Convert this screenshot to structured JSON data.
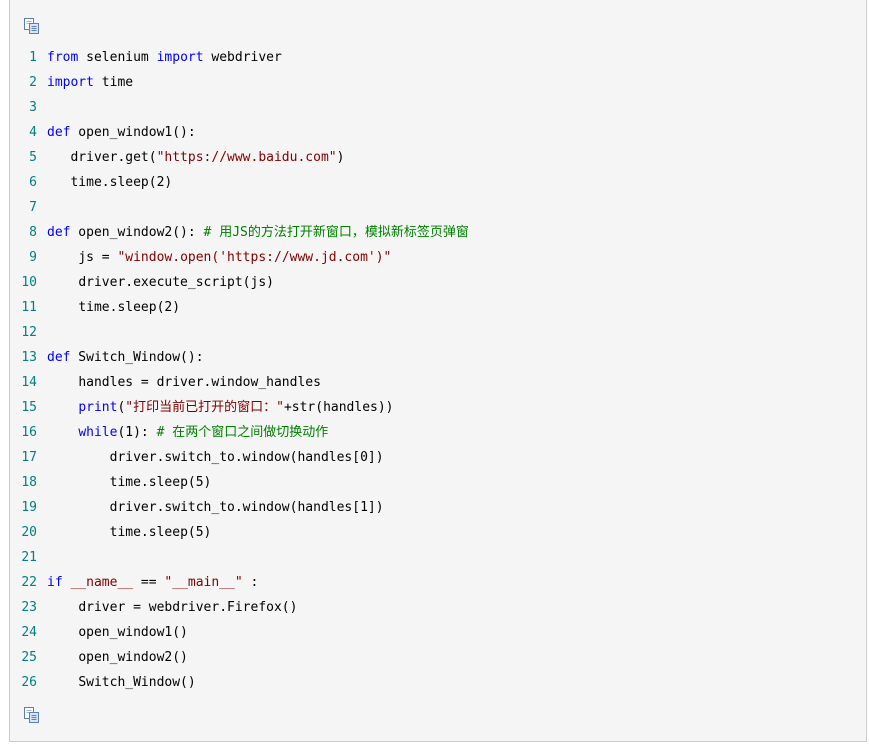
{
  "toolbar": {
    "copy_icon": "copy-icon",
    "copy_icon_bottom": "copy-icon"
  },
  "colors": {
    "keyword": "#0000ff",
    "string": "#800000",
    "comment": "#008000",
    "line_number": "#008080",
    "text": "#000000",
    "background": "#f5f5f5"
  },
  "code": {
    "lines": [
      {
        "n": "1",
        "indent": "",
        "tokens": [
          {
            "t": "kw",
            "v": "from"
          },
          {
            "t": "tx",
            "v": " selenium "
          },
          {
            "t": "kw",
            "v": "import"
          },
          {
            "t": "tx",
            "v": " webdriver"
          }
        ]
      },
      {
        "n": "2",
        "indent": "",
        "tokens": [
          {
            "t": "kw",
            "v": "import"
          },
          {
            "t": "tx",
            "v": " time"
          }
        ]
      },
      {
        "n": "3",
        "indent": "",
        "tokens": []
      },
      {
        "n": "4",
        "indent": "",
        "tokens": [
          {
            "t": "kw",
            "v": "def"
          },
          {
            "t": "tx",
            "v": " open_window1():"
          }
        ]
      },
      {
        "n": "5",
        "indent": "   ",
        "tokens": [
          {
            "t": "tx",
            "v": "driver.get("
          },
          {
            "t": "str",
            "v": "\"https://www.baidu.com\""
          },
          {
            "t": "tx",
            "v": ")"
          }
        ]
      },
      {
        "n": "6",
        "indent": "   ",
        "tokens": [
          {
            "t": "tx",
            "v": "time.sleep(2)"
          }
        ]
      },
      {
        "n": "7",
        "indent": "",
        "tokens": []
      },
      {
        "n": "8",
        "indent": "",
        "tokens": [
          {
            "t": "kw",
            "v": "def"
          },
          {
            "t": "tx",
            "v": " open_window2(): "
          },
          {
            "t": "cm",
            "v": "# 用JS的方法打开新窗口，模拟新标签页弹窗"
          }
        ]
      },
      {
        "n": "9",
        "indent": "    ",
        "tokens": [
          {
            "t": "tx",
            "v": "js = "
          },
          {
            "t": "str",
            "v": "\"window.open('https://www.jd.com')\""
          }
        ]
      },
      {
        "n": "10",
        "indent": "    ",
        "tokens": [
          {
            "t": "tx",
            "v": "driver.execute_script(js)"
          }
        ]
      },
      {
        "n": "11",
        "indent": "    ",
        "tokens": [
          {
            "t": "tx",
            "v": "time.sleep(2)"
          }
        ]
      },
      {
        "n": "12",
        "indent": "",
        "tokens": []
      },
      {
        "n": "13",
        "indent": "",
        "tokens": [
          {
            "t": "kw",
            "v": "def"
          },
          {
            "t": "tx",
            "v": " Switch_Window():"
          }
        ]
      },
      {
        "n": "14",
        "indent": "    ",
        "tokens": [
          {
            "t": "tx",
            "v": "handles = driver.window_handles"
          }
        ]
      },
      {
        "n": "15",
        "indent": "    ",
        "tokens": [
          {
            "t": "kw",
            "v": "print"
          },
          {
            "t": "tx",
            "v": "("
          },
          {
            "t": "str",
            "v": "\"打印当前已打开的窗口：\""
          },
          {
            "t": "tx",
            "v": "+str(handles))"
          }
        ]
      },
      {
        "n": "16",
        "indent": "    ",
        "tokens": [
          {
            "t": "kw",
            "v": "while"
          },
          {
            "t": "tx",
            "v": "(1): "
          },
          {
            "t": "cm",
            "v": "# 在两个窗口之间做切换动作"
          }
        ]
      },
      {
        "n": "17",
        "indent": "        ",
        "tokens": [
          {
            "t": "tx",
            "v": "driver.switch_to.window(handles[0])"
          }
        ]
      },
      {
        "n": "18",
        "indent": "        ",
        "tokens": [
          {
            "t": "tx",
            "v": "time.sleep(5)"
          }
        ]
      },
      {
        "n": "19",
        "indent": "        ",
        "tokens": [
          {
            "t": "tx",
            "v": "driver.switch_to.window(handles[1])"
          }
        ]
      },
      {
        "n": "20",
        "indent": "        ",
        "tokens": [
          {
            "t": "tx",
            "v": "time.sleep(5)"
          }
        ]
      },
      {
        "n": "21",
        "indent": "",
        "tokens": []
      },
      {
        "n": "22",
        "indent": "",
        "tokens": [
          {
            "t": "kw",
            "v": "if"
          },
          {
            "t": "tx",
            "v": " "
          },
          {
            "t": "str",
            "v": "__name__"
          },
          {
            "t": "tx",
            "v": " == "
          },
          {
            "t": "str",
            "v": "\"__main__\""
          },
          {
            "t": "tx",
            "v": " :"
          }
        ]
      },
      {
        "n": "23",
        "indent": "    ",
        "tokens": [
          {
            "t": "tx",
            "v": "driver = webdriver.Firefox()"
          }
        ]
      },
      {
        "n": "24",
        "indent": "    ",
        "tokens": [
          {
            "t": "tx",
            "v": "open_window1()"
          }
        ]
      },
      {
        "n": "25",
        "indent": "    ",
        "tokens": [
          {
            "t": "tx",
            "v": "open_window2()"
          }
        ]
      },
      {
        "n": "26",
        "indent": "    ",
        "tokens": [
          {
            "t": "tx",
            "v": "Switch_Window()"
          }
        ]
      }
    ]
  }
}
